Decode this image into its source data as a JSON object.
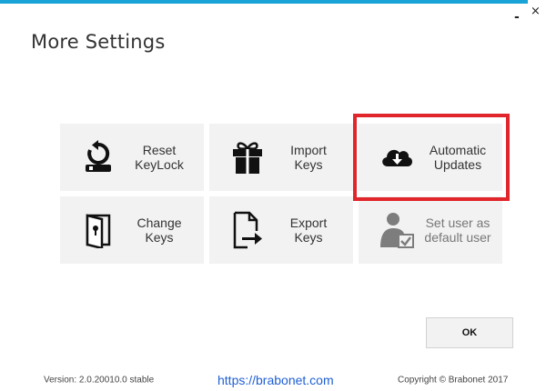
{
  "window": {
    "title": "More Settings",
    "minimize_glyph": "-",
    "close_glyph": "×",
    "accent_color": "#1aa3d6"
  },
  "tiles": [
    {
      "label": "Reset\nKeyLock",
      "icon": "reset-lock-icon",
      "enabled": true
    },
    {
      "label": "Import\nKeys",
      "icon": "gift-icon",
      "enabled": true
    },
    {
      "label": "Automatic\nUpdates",
      "icon": "cloud-download-icon",
      "enabled": true,
      "highlighted": true
    },
    {
      "label": "Change\nKeys",
      "icon": "door-key-icon",
      "enabled": true
    },
    {
      "label": "Export\nKeys",
      "icon": "file-export-icon",
      "enabled": true
    },
    {
      "label": "Set user as\ndefault user",
      "icon": "user-check-icon",
      "enabled": false
    }
  ],
  "highlight_color": "#e0262b",
  "ok_button": {
    "label": "OK"
  },
  "footer": {
    "version": "Version: 2.0.20010.0 stable",
    "link": "https://brabonet.com",
    "copyright": "Copyright © Brabonet 2017"
  }
}
